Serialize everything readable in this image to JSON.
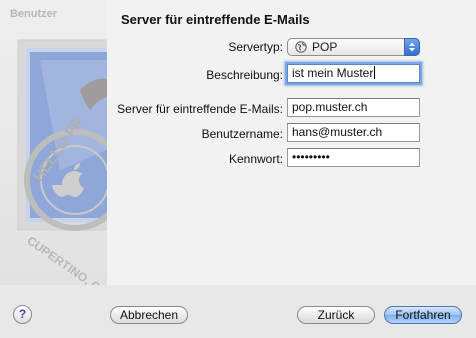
{
  "background_title": "Benutzer",
  "heading": "Server für eintreffende E-Mails",
  "stamp_text": {
    "top": "HELLO FR",
    "bottom": "CUPERTINO, CA"
  },
  "form": {
    "server_type": {
      "label": "Servertyp:",
      "value": "POP",
      "icon": "globe-icon"
    },
    "description": {
      "label": "Beschreibung:",
      "value": "ist mein Muster"
    },
    "incoming_server": {
      "label": "Server für eintreffende E-Mails:",
      "value": "pop.muster.ch"
    },
    "username": {
      "label": "Benutzername:",
      "value": "hans@muster.ch"
    },
    "password": {
      "label": "Kennwort:",
      "value": "•••••••••"
    }
  },
  "buttons": {
    "help": "?",
    "cancel": "Abbrechen",
    "back": "Zurück",
    "continue": "Fortfahren"
  },
  "colors": {
    "accent": "#7eafee",
    "focus_ring": "#7aa7e8"
  }
}
